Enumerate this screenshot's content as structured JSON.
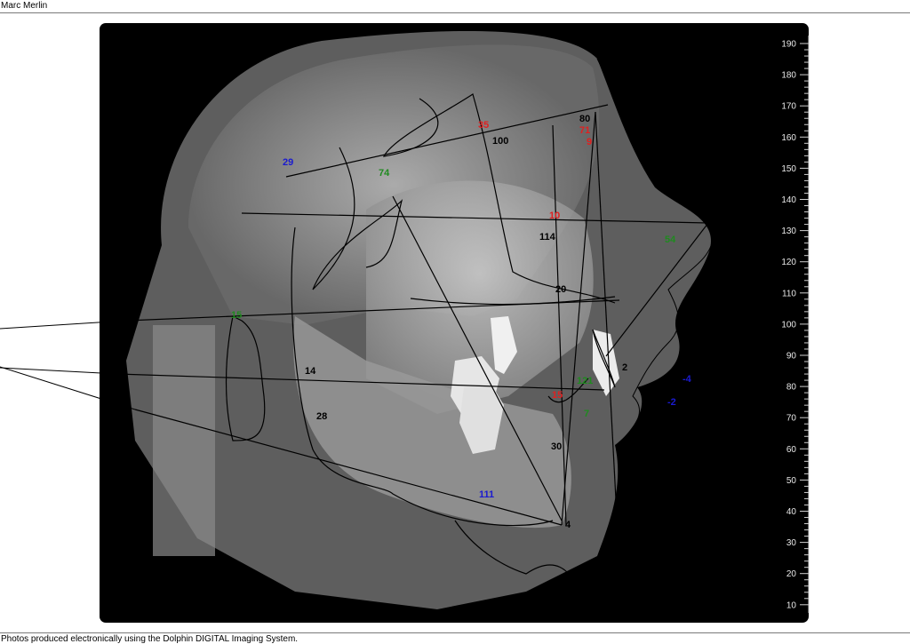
{
  "header": {
    "patient_name": "Marc Merlin"
  },
  "footer": {
    "note": "Photos produced electronically using the Dolphin DIGITAL Imaging System."
  },
  "ruler": {
    "ticks": [
      "190",
      "180",
      "170",
      "160",
      "150",
      "140",
      "130",
      "120",
      "110",
      "100",
      "90",
      "80",
      "70",
      "60",
      "50",
      "40",
      "30",
      "20",
      "10"
    ]
  },
  "labels": {
    "l29": "29",
    "l74": "74",
    "l35": "35",
    "l100": "100",
    "l80": "80",
    "l71": "71",
    "l9": "9",
    "l10": "10",
    "l114": "114",
    "l54": "54",
    "l20": "20",
    "l15a": "15",
    "l14": "14",
    "l2": "2",
    "lm4": "-4",
    "l121": "121",
    "l15b": "15",
    "lm2": "-2",
    "l28": "28",
    "l7": "7",
    "l30": "30",
    "l111": "111",
    "l4": "4"
  },
  "colors": {
    "red": "#e02020",
    "green": "#1f8a1f",
    "blue": "#1a1ad0",
    "black": "#000000"
  }
}
